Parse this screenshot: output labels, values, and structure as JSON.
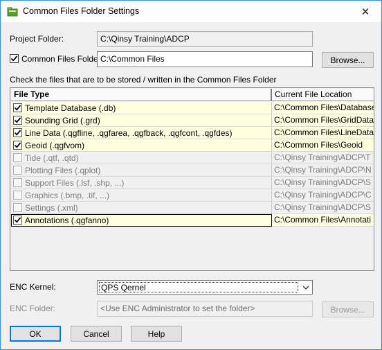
{
  "window": {
    "title": "Common Files Folder Settings",
    "close_glyph": "✕"
  },
  "project_folder": {
    "label": "Project Folder:",
    "value": "C:\\Qinsy Training\\ADCP"
  },
  "common_folder": {
    "label": "Common Files Folder:",
    "checked": true,
    "value": "C:\\Common Files",
    "browse_label": "Browse..."
  },
  "instruction": "Check the files that are to be stored / written in the Common Files Folder",
  "file_list": {
    "columns": [
      "File Type",
      "Current File Location"
    ],
    "rows": [
      {
        "type": "Template Database (.db)",
        "location": "C:\\Common Files\\Database",
        "checked": true,
        "enabled": true
      },
      {
        "type": "Sounding Grid (.grd)",
        "location": "C:\\Common Files\\GridData",
        "checked": true,
        "enabled": true
      },
      {
        "type": "Line Data (.qgfline, .qgfarea, .qgfback, .qgfcont, .qgfdes)",
        "location": "C:\\Common Files\\LineData",
        "checked": true,
        "enabled": true
      },
      {
        "type": "Geoid (.qgfvom)",
        "location": "C:\\Common Files\\Geoid",
        "checked": true,
        "enabled": true
      },
      {
        "type": "Tide (.qtf, .qtd)",
        "location": "C:\\Qinsy Training\\ADCP\\T",
        "checked": false,
        "enabled": false
      },
      {
        "type": "Plotting Files (.qplot)",
        "location": "C:\\Qinsy Training\\ADCP\\N",
        "checked": false,
        "enabled": false
      },
      {
        "type": "Support Files (.lsf, .shp, ...)",
        "location": "C:\\Qinsy Training\\ADCP\\S",
        "checked": false,
        "enabled": false
      },
      {
        "type": "Graphics (.bmp, .tif, ...)",
        "location": "C:\\Qinsy Training\\ADCP\\C",
        "checked": false,
        "enabled": false
      },
      {
        "type": "Settings (.xml)",
        "location": "C:\\Qinsy Training\\ADCP\\S",
        "checked": false,
        "enabled": false
      },
      {
        "type": "Annotations (.qgfanno)",
        "location": "C:\\Common Files\\Annotati",
        "checked": true,
        "enabled": true,
        "selected": true
      }
    ]
  },
  "enc_kernel": {
    "label": "ENC Kernel:",
    "value": "QPS Qernel"
  },
  "enc_folder": {
    "label": "ENC Folder:",
    "placeholder": "<Use ENC Administrator to set the folder>",
    "browse_label": "Browse..."
  },
  "buttons": {
    "ok": "OK",
    "cancel": "Cancel",
    "help": "Help"
  },
  "colors": {
    "enabled_row_bg": "#ffffe1",
    "window_bg": "#f0f0f0",
    "accent": "#0078d7"
  }
}
